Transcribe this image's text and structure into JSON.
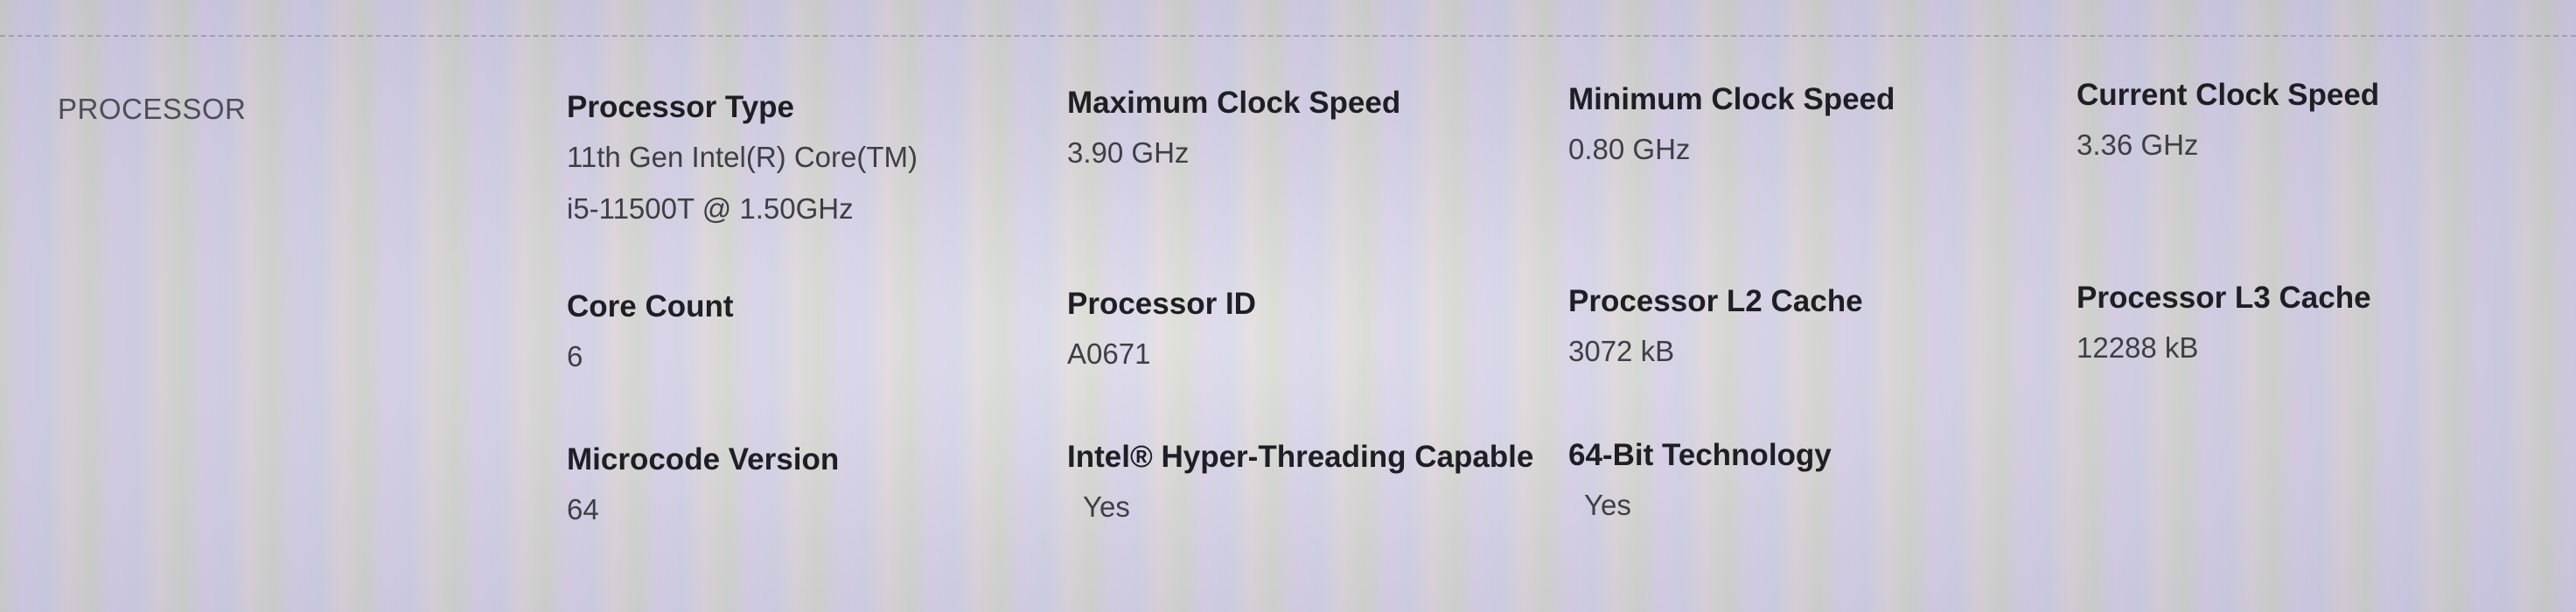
{
  "section": {
    "title": "PROCESSOR"
  },
  "fields": {
    "processor_type": {
      "label": "Processor Type",
      "value_line1": "11th Gen Intel(R) Core(TM)",
      "value_line2": "i5-11500T @ 1.50GHz"
    },
    "max_clock": {
      "label": "Maximum Clock Speed",
      "value": "3.90 GHz"
    },
    "min_clock": {
      "label": "Minimum Clock Speed",
      "value": "0.80 GHz"
    },
    "current_clock": {
      "label": "Current Clock Speed",
      "value": "3.36 GHz"
    },
    "core_count": {
      "label": "Core Count",
      "value": "6"
    },
    "processor_id": {
      "label": "Processor ID",
      "value": "A0671"
    },
    "l2_cache": {
      "label": "Processor L2 Cache",
      "value": "3072 kB"
    },
    "l3_cache": {
      "label": "Processor L3 Cache",
      "value": "12288 kB"
    },
    "microcode": {
      "label": "Microcode Version",
      "value": "64"
    },
    "hyperthreading": {
      "label": "Intel® Hyper-Threading Capable",
      "value": "Yes"
    },
    "bit64": {
      "label": "64-Bit Technology",
      "value": "Yes"
    }
  }
}
